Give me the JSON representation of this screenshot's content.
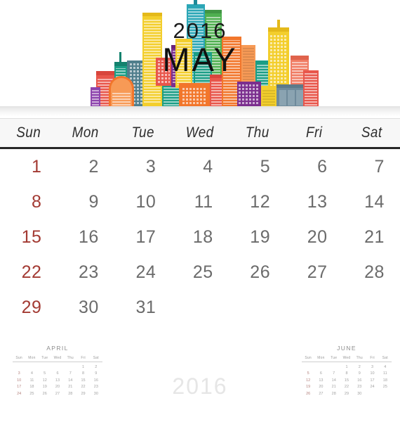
{
  "hero": {
    "year_label": "2016",
    "month_label": "MAY",
    "illustration": "cityscape-illustration",
    "palette": {
      "coral_red": "#E8564B",
      "salmon": "#F07C63",
      "orange": "#F2762B",
      "orange_light": "#F79A56",
      "yellow": "#F3CE2C",
      "yellow_deep": "#EFBD1F",
      "teal": "#1B9E86",
      "teal_dark": "#14826E",
      "cyan": "#2BA6B6",
      "green": "#4FB050",
      "purple": "#7B2E8E",
      "violet": "#8E44AD",
      "slate_blue": "#6E8A9B",
      "blue_gray": "#5C7A8A"
    }
  },
  "weekdays": [
    "Sun",
    "Mon",
    "Tue",
    "Wed",
    "Thu",
    "Fri",
    "Sat"
  ],
  "calendar": {
    "month": "MAY",
    "year": "2016",
    "accent_sunday_color": "#A33A33",
    "weekday_color": "#6B6B6B",
    "weeks": [
      [
        "1",
        "2",
        "3",
        "4",
        "5",
        "6",
        "7"
      ],
      [
        "8",
        "9",
        "10",
        "11",
        "12",
        "13",
        "14"
      ],
      [
        "15",
        "16",
        "17",
        "18",
        "19",
        "20",
        "21"
      ],
      [
        "22",
        "23",
        "24",
        "25",
        "26",
        "27",
        "28"
      ],
      [
        "29",
        "30",
        "31",
        "",
        "",
        "",
        ""
      ]
    ]
  },
  "footer": {
    "watermark_year": "2016",
    "mini_weekdays": [
      "Sun",
      "Mon",
      "Tue",
      "Wed",
      "Thu",
      "Fri",
      "Sat"
    ],
    "prev_month": {
      "title": "APRIL",
      "weeks": [
        [
          "",
          "",
          "",
          "",
          "",
          "1",
          "2"
        ],
        [
          "3",
          "4",
          "5",
          "6",
          "7",
          "8",
          "9"
        ],
        [
          "10",
          "11",
          "12",
          "13",
          "14",
          "15",
          "16"
        ],
        [
          "17",
          "18",
          "19",
          "20",
          "21",
          "22",
          "23"
        ],
        [
          "24",
          "25",
          "26",
          "27",
          "28",
          "29",
          "30"
        ]
      ]
    },
    "next_month": {
      "title": "JUNE",
      "weeks": [
        [
          "",
          "",
          "",
          "1",
          "2",
          "3",
          "4"
        ],
        [
          "5",
          "6",
          "7",
          "8",
          "9",
          "10",
          "11"
        ],
        [
          "12",
          "13",
          "14",
          "15",
          "16",
          "17",
          "18"
        ],
        [
          "19",
          "20",
          "21",
          "22",
          "23",
          "24",
          "25"
        ],
        [
          "26",
          "27",
          "28",
          "29",
          "30",
          "",
          ""
        ]
      ]
    }
  }
}
